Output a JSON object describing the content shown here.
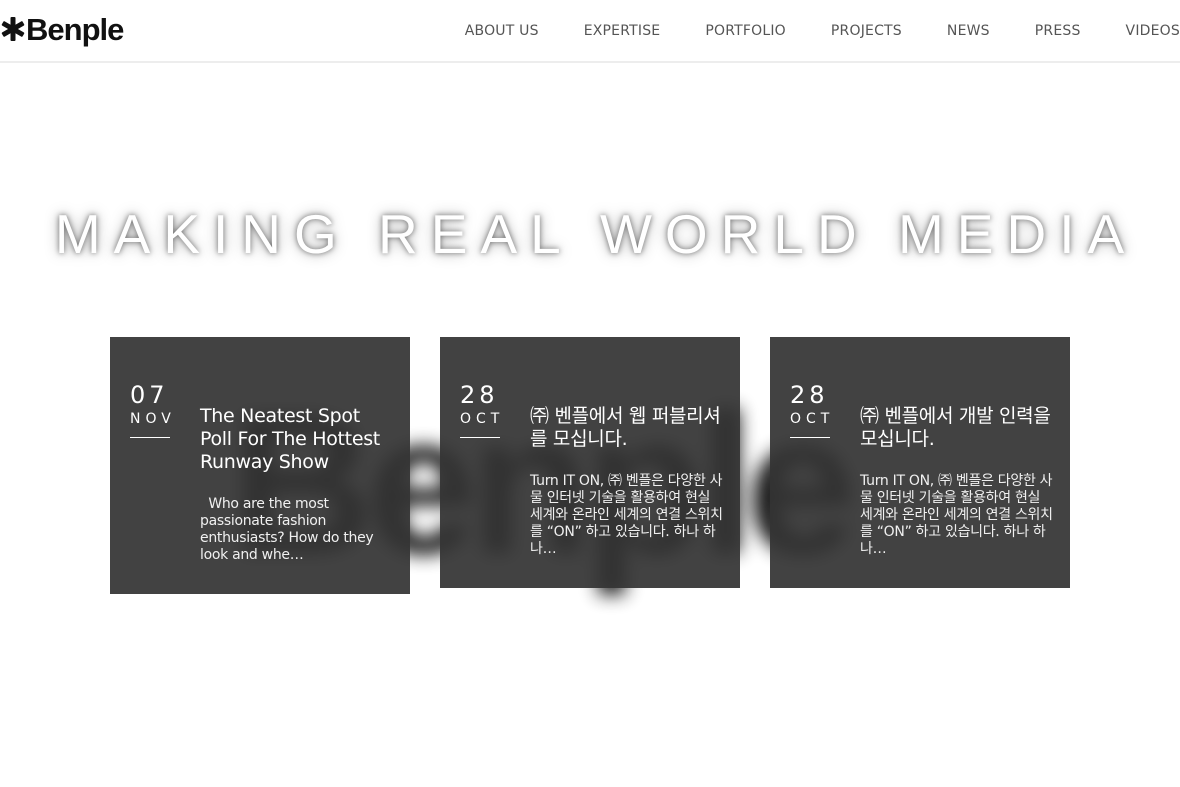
{
  "header": {
    "logo_text": "Benple",
    "nav": [
      {
        "label": "ABOUT US"
      },
      {
        "label": "EXPERTISE"
      },
      {
        "label": "PORTFOLIO"
      },
      {
        "label": "PROJECTS"
      },
      {
        "label": "NEWS"
      },
      {
        "label": "PRESS"
      },
      {
        "label": "VIDEOS"
      }
    ]
  },
  "hero": {
    "title": "MAKING REAL WORLD MEDIA",
    "background_logo": "Benple"
  },
  "posts": [
    {
      "day": "07",
      "month": "NOV",
      "title": "The Neatest Spot Poll For The Hottest Runway Show",
      "excerpt": "Who are the most passionate fashion enthusiasts? How do they look and whe…"
    },
    {
      "day": "28",
      "month": "OCT",
      "title": "㈜ 벤플에서 웹 퍼블리셔를 모십니다.",
      "excerpt": "Turn IT ON, ㈜ 벤플은 다양한 사물 인터넷 기술을 활용하여 현실 세계와 온라인 세계의 연결 스위치를 “ON” 하고 있습니다. 하나 하나…"
    },
    {
      "day": "28",
      "month": "OCT",
      "title": "㈜ 벤플에서 개발 인력을 모십니다.",
      "excerpt": "Turn IT ON, ㈜ 벤플은 다양한 사물 인터넷 기술을 활용하여 현실 세계와 온라인 세계의 연결 스위치를 “ON” 하고 있습니다. 하나 하나…"
    }
  ],
  "colors": {
    "card_background": "#343434",
    "nav_text": "#555555",
    "logo": "#111111"
  },
  "icons": {
    "logo_mark": "asterisk-star-icon"
  }
}
